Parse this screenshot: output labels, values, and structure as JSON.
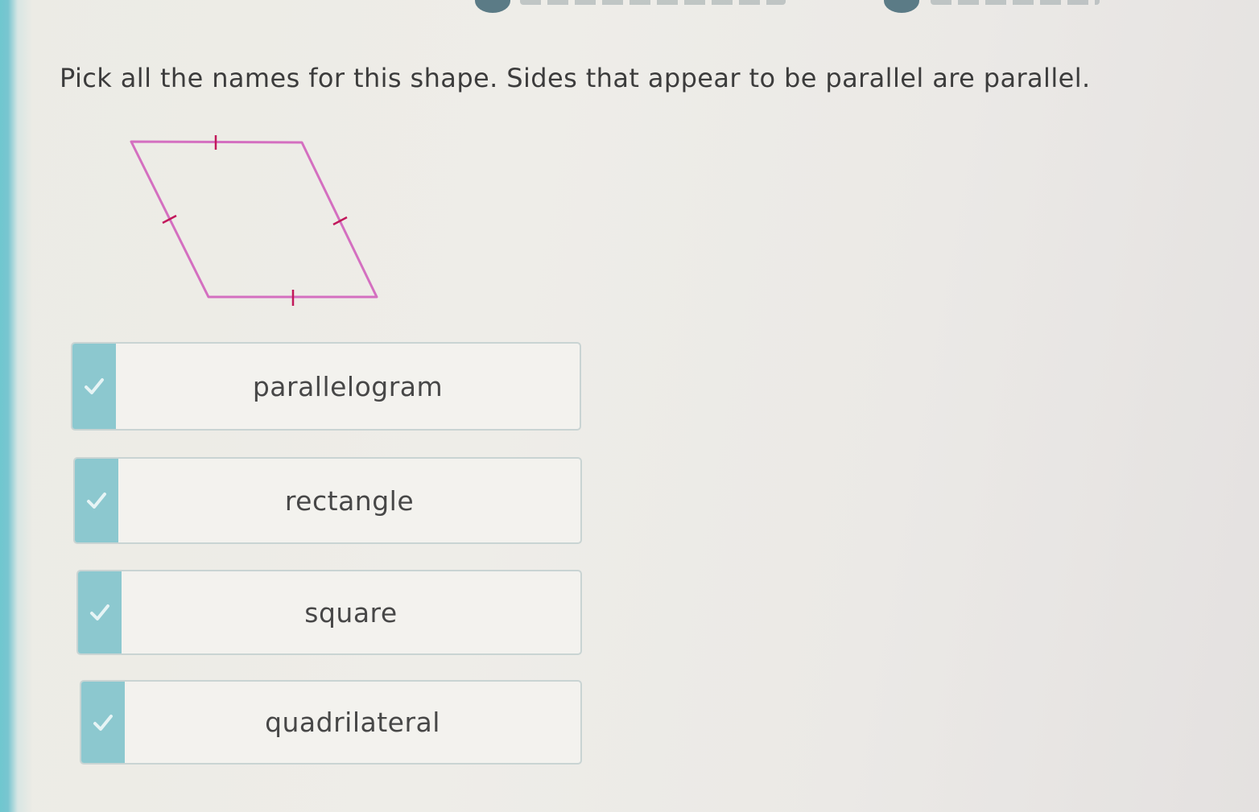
{
  "question": {
    "text": "Pick all the names for this shape. Sides that appear to be parallel are parallel."
  },
  "figure": {
    "shape": "rhombus",
    "stroke_color": "#d46fc0",
    "tick_color": "#c2185b"
  },
  "choices": [
    {
      "label": "parallelogram",
      "icon": "check-icon"
    },
    {
      "label": "rectangle",
      "icon": "check-icon"
    },
    {
      "label": "square",
      "icon": "check-icon"
    },
    {
      "label": "quadrilateral",
      "icon": "check-icon"
    }
  ],
  "colors": {
    "accent": "#8cc8cf",
    "check": "#e6f4f5"
  }
}
